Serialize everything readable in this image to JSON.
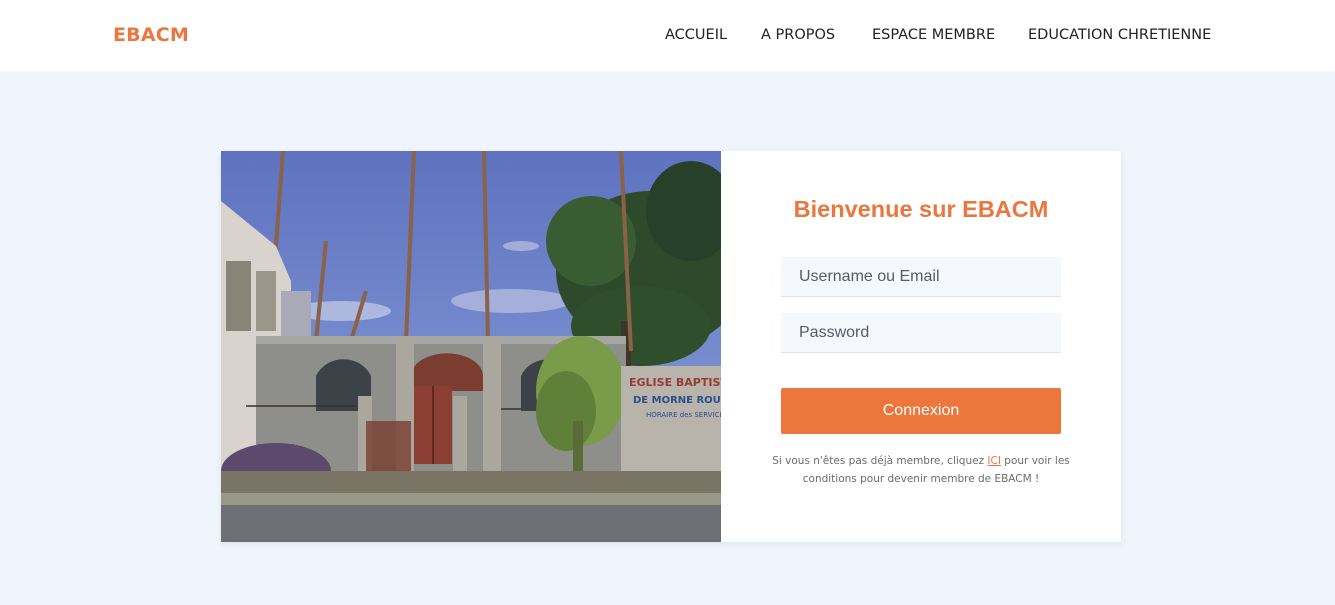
{
  "navbar": {
    "brand": "EBACM",
    "links": [
      "ACCUEIL",
      "A PROPOS",
      "ESPACE MEMBRE",
      "EDUCATION CHRETIENNE"
    ]
  },
  "login": {
    "title": "Bienvenue sur EBACM",
    "username_placeholder": "Username ou Email",
    "password_placeholder": "Password",
    "submit_label": "Connexion",
    "note_before": "Si vous n'êtes pas déjà membre, cliquez ",
    "note_link": "ICI",
    "note_after": " pour voir les conditions pour devenir membre de EBACM !"
  },
  "photo": {
    "sign_line1": "EGLISE BAPTISTE",
    "sign_line2": "DE MORNE ROUGE",
    "sign_line3": "HORAIRE des SERVICES"
  },
  "colors": {
    "accent": "#e9773f",
    "button": "#ec763b",
    "page_background": "#f0f5fd"
  }
}
